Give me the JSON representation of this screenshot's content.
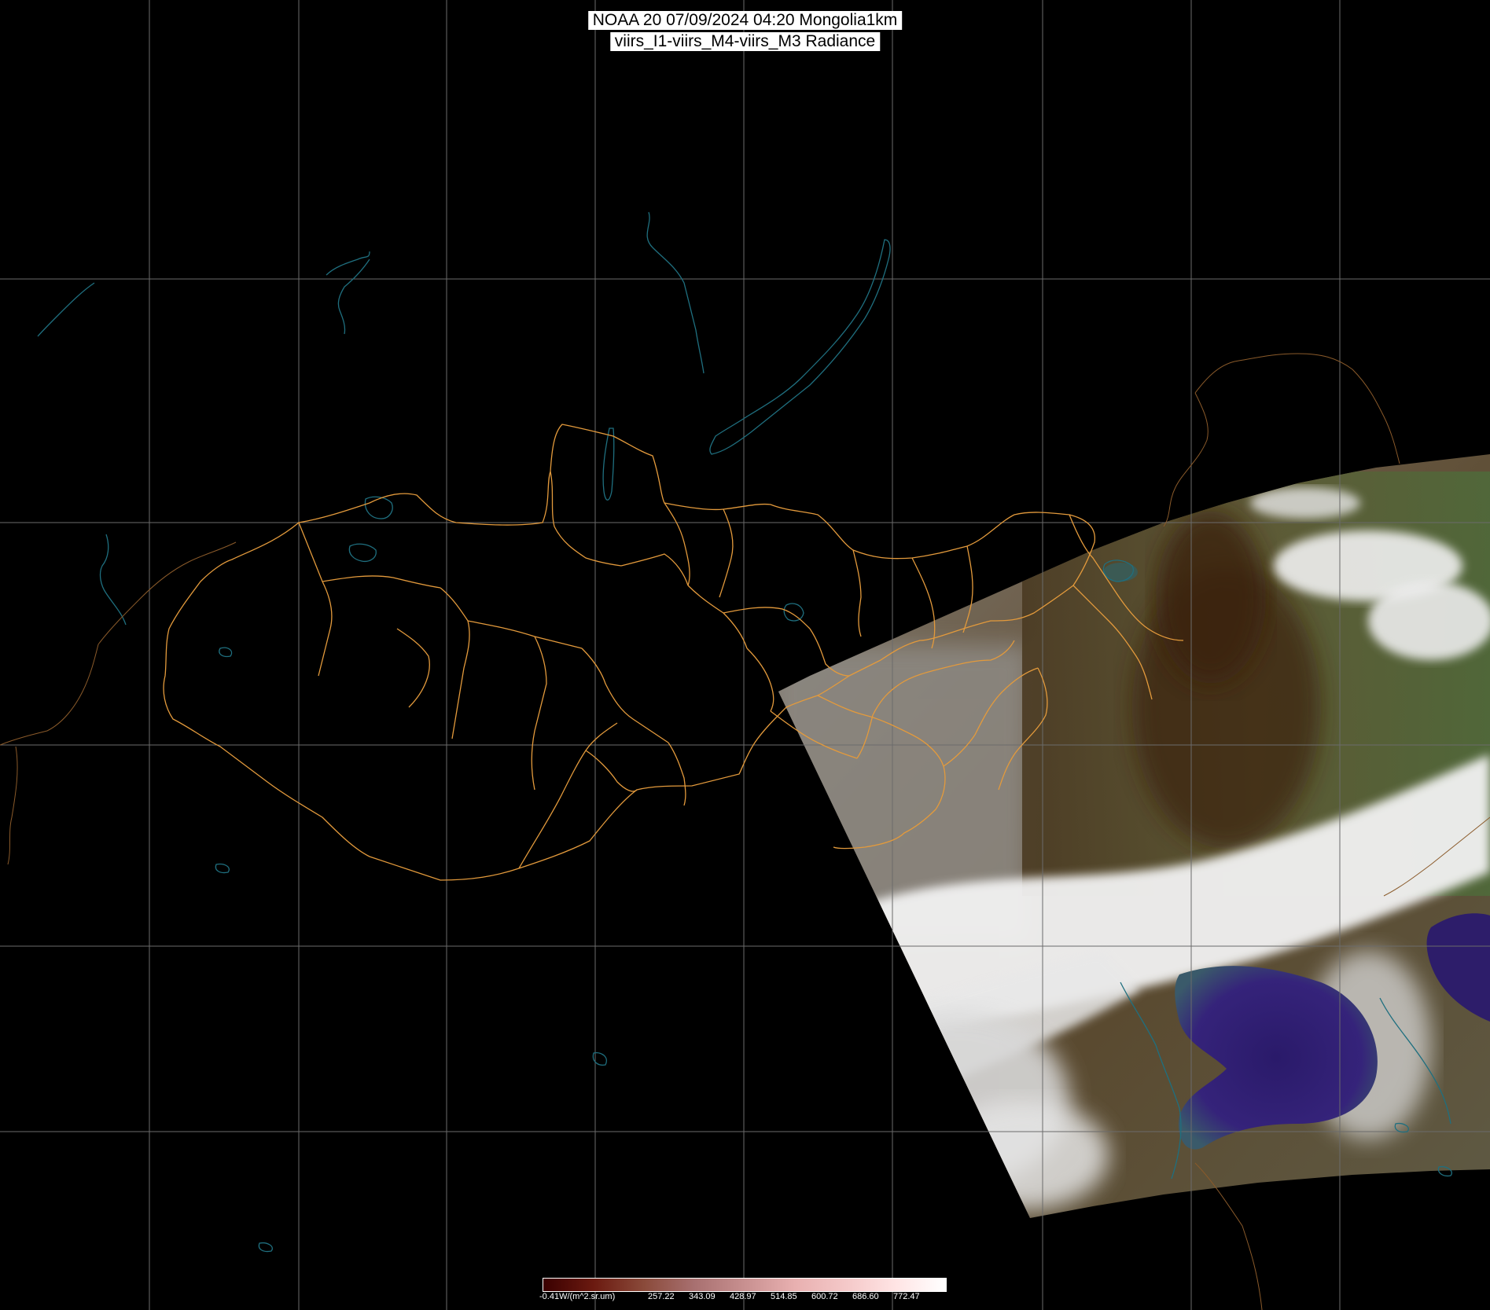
{
  "title": {
    "line1": "NOAA 20 07/09/2024 04:20 Mongolia1km",
    "line2": "viirs_I1-viirs_M4-viirs_M3 Radiance"
  },
  "colors": {
    "background": "#000000",
    "gridlines": "#6b6b6b",
    "province_borders": "#e39a3c",
    "water_bodies": "#1f6f7f",
    "country_borders": "#8a5a2a"
  },
  "colorbar": {
    "labels": [
      "-0.41W/(m^2.sr.um)",
      "257.22",
      "343.09",
      "428.97",
      "514.85",
      "600.72",
      "686.60",
      "772.47"
    ],
    "color_stops": [
      "#3a0000",
      "#6b1a10",
      "#8a4a3a",
      "#a87070",
      "#c89090",
      "#e8b0b0",
      "#f4c8c8",
      "#ffe4e4",
      "#ffffff"
    ]
  }
}
